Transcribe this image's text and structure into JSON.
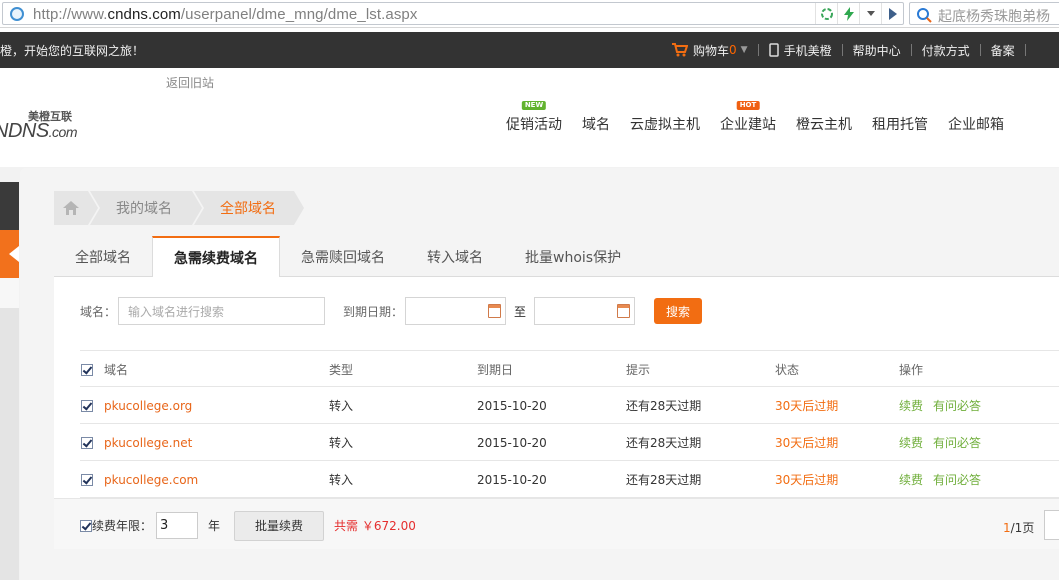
{
  "browser": {
    "url_scheme": "http://www.",
    "url_host": "cndns.com",
    "url_path": "/userpanel/dme_mng/dme_lst.aspx",
    "search_text": "起底杨秀珠胞弟杨"
  },
  "topbar": {
    "welcome": "橙，开始您的互联网之旅！",
    "cart_label": "购物车",
    "cart_count": "0",
    "mobile_label": "手机美橙",
    "help_label": "帮助中心",
    "payment_label": "付款方式",
    "beian_label": "备案"
  },
  "header": {
    "back_old": "返回旧站",
    "logo_cn": "美橙互联",
    "logo_en": "NDNS",
    "logo_com": ".com",
    "nav": [
      {
        "label": "促销活动",
        "badge": "NEW"
      },
      {
        "label": "域名",
        "badge": ""
      },
      {
        "label": "云虚拟主机",
        "badge": ""
      },
      {
        "label": "企业建站",
        "badge": "HOT"
      },
      {
        "label": "橙云主机",
        "badge": ""
      },
      {
        "label": "租用托管",
        "badge": ""
      },
      {
        "label": "企业邮箱",
        "badge": ""
      }
    ]
  },
  "breadcrumb": {
    "level1": "我的域名",
    "current": "全部域名"
  },
  "tabs": [
    "全部域名",
    "急需续费域名",
    "急需赎回域名",
    "转入域名",
    "批量whois保护"
  ],
  "active_tab": "急需续费域名",
  "filter": {
    "domain_label": "域名：",
    "domain_placeholder": "输入域名进行搜索",
    "expire_label": "到期日期：",
    "to_label": "至",
    "search_button": "搜索"
  },
  "table": {
    "headers": {
      "name": "域名",
      "type": "类型",
      "expire": "到期日",
      "tip": "提示",
      "status": "状态",
      "action": "操作"
    },
    "rows": [
      {
        "name": "pkucollege.org",
        "type": "转入",
        "expire": "2015-10-20",
        "tip": "还有28天过期",
        "status": "30天后过期",
        "renew": "续费",
        "faq": "有问必答"
      },
      {
        "name": "pkucollege.net",
        "type": "转入",
        "expire": "2015-10-20",
        "tip": "还有28天过期",
        "status": "30天后过期",
        "renew": "续费",
        "faq": "有问必答"
      },
      {
        "name": "pkucollege.com",
        "type": "转入",
        "expire": "2015-10-20",
        "tip": "还有28天过期",
        "status": "30天后过期",
        "renew": "续费",
        "faq": "有问必答"
      }
    ]
  },
  "footer": {
    "years_label": "续费年限：",
    "years_value": "3",
    "years_unit": "年",
    "batch_button": "批量续费",
    "total_label": "共需",
    "total_value": "￥672.00",
    "page_current": "1",
    "page_total": "/1页"
  },
  "colors": {
    "accent": "#f26d12",
    "dark_bar": "#333333",
    "green_link": "#6fae3a",
    "total_red": "#e52e2e"
  }
}
